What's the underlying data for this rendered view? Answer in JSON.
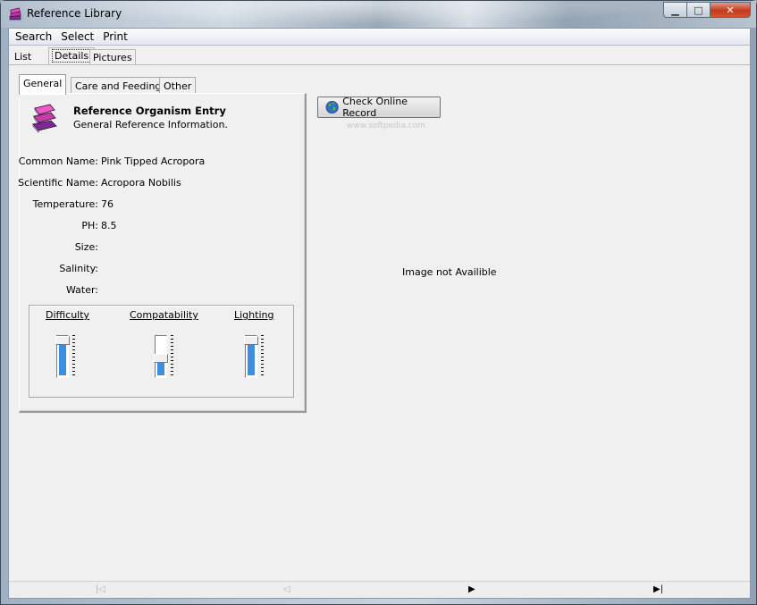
{
  "window": {
    "title": "Reference Library"
  },
  "menu": {
    "items": [
      "Search",
      "Select",
      "Print"
    ]
  },
  "main_tabs": {
    "items": [
      "List",
      "Details",
      "Pictures"
    ],
    "active": "Details"
  },
  "sub_tabs": {
    "items": [
      "General",
      "Care and Feeding",
      "Other"
    ],
    "active": "General"
  },
  "entry": {
    "title": "Reference Organism Entry",
    "subtitle": "General Reference Information."
  },
  "fields": [
    {
      "label": "Common Name:",
      "value": "Pink Tipped Acropora"
    },
    {
      "label": "Scientific Name:",
      "value": "Acropora Nobilis"
    },
    {
      "label": "Temperature:",
      "value": "76"
    },
    {
      "label": "PH:",
      "value": "8.5"
    },
    {
      "label": "Size:",
      "value": ""
    },
    {
      "label": "Salinity:",
      "value": ""
    },
    {
      "label": "Water:",
      "value": ""
    }
  ],
  "sliders": [
    {
      "label": "Difficulty",
      "level": 0.9
    },
    {
      "label": "Compatability",
      "level": 0.45
    },
    {
      "label": "Lighting",
      "level": 0.9
    }
  ],
  "actions": {
    "check_online": "Check Online Record"
  },
  "image_panel": {
    "message": "Image not Availible"
  },
  "watermark": "www.softpedia.com",
  "navigation": {
    "first": "|◁",
    "prev": "◁",
    "next": "▶",
    "last": "▶|"
  },
  "colors": {
    "accent": "#3e8ee0",
    "close_button": "#c23b1c"
  },
  "icons": {
    "app": "books-icon",
    "online": "globe-icon"
  }
}
